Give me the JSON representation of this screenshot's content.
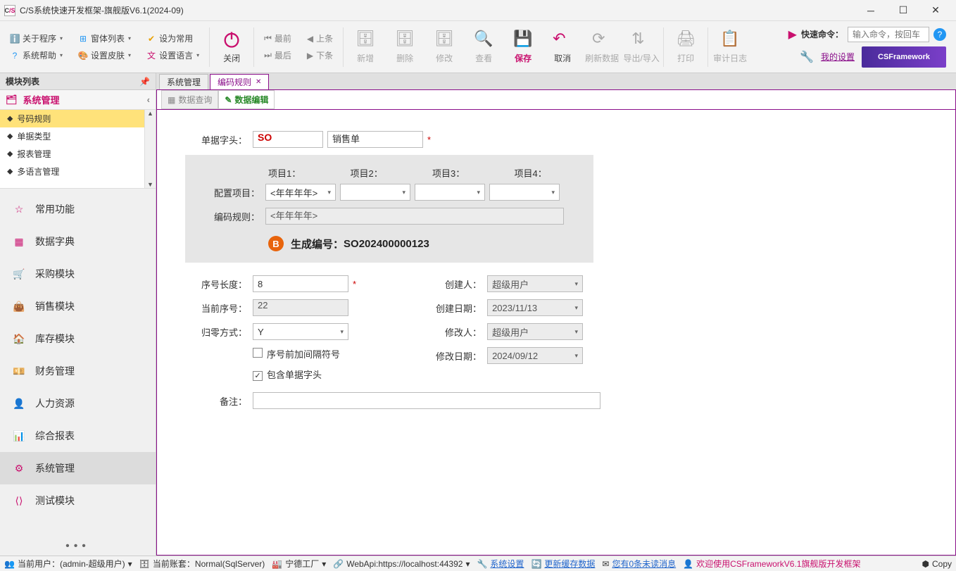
{
  "window": {
    "title": "C/S系统快速开发框架-旗舰版V6.1(2024-09)"
  },
  "menu": {
    "about": "关于程序",
    "formlist": "窗体列表",
    "sethome": "设为常用",
    "syshelp": "系统帮助",
    "skin": "设置皮肤",
    "lang": "设置语言"
  },
  "ribbon": {
    "close": "关闭",
    "first": "最前",
    "prev": "上条",
    "last": "最后",
    "next": "下条",
    "add": "新增",
    "del": "删除",
    "edit": "修改",
    "view": "查看",
    "save": "保存",
    "cancel": "取消",
    "refresh": "刷新数据",
    "impexp": "导出/导入",
    "print": "打印",
    "audit": "审计日志",
    "quick": "快速命令：",
    "quick_ph": "输入命令，按回车",
    "mysettings": "我的设置",
    "promo": "CSFramework"
  },
  "sidebar": {
    "header": "模块列表",
    "section": "系统管理",
    "tree": [
      "号码规则",
      "单据类型",
      "报表管理",
      "多语言管理"
    ],
    "nav": [
      "常用功能",
      "数据字典",
      "采购模块",
      "销售模块",
      "库存模块",
      "财务管理",
      "人力资源",
      "综合报表",
      "系统管理",
      "测试模块"
    ]
  },
  "tabs1": [
    "系统管理",
    "编码规则"
  ],
  "tabs2": [
    "数据查询",
    "数据编辑"
  ],
  "form": {
    "prefix_lbl": "单据字头：",
    "prefix_val": "SO",
    "prefix_name": "销售单",
    "cfg_lbl": "配置项目：",
    "seg1": "项目1：",
    "seg2": "项目2：",
    "seg3": "项目3：",
    "seg4": "项目4：",
    "seg1_val": "<年年年年>",
    "rule_lbl": "编码规则：",
    "rule_val": "<年年年年>",
    "gen_lbl": "生成编号：",
    "gen_val": "SO202400000123",
    "len_lbl": "序号长度：",
    "len_val": "8",
    "cur_lbl": "当前序号：",
    "cur_val": "22",
    "reset_lbl": "归零方式：",
    "reset_val": "Y",
    "cb1": "序号前加间隔符号",
    "cb2": "包含单据字头",
    "creator_lbl": "创建人：",
    "creator_val": "超级用户",
    "cdate_lbl": "创建日期：",
    "cdate_val": "2023/11/13",
    "moduser_lbl": "修改人：",
    "moduser_val": "超级用户",
    "mdate_lbl": "修改日期：",
    "mdate_val": "2024/09/12",
    "remark_lbl": "备注："
  },
  "status": {
    "user": "当前用户：(admin-超级用户)",
    "db": "当前账套：Normal(SqlServer)",
    "factory": "宁德工厂",
    "api": "WebApi:https://localhost:44392",
    "sys": "系统设置",
    "cache": "更新缓存数据",
    "msg": "您有0条未读消息",
    "welcome": "欢迎使用CSFrameworkV6.1旗舰版开发框架",
    "copy": "Copy"
  }
}
